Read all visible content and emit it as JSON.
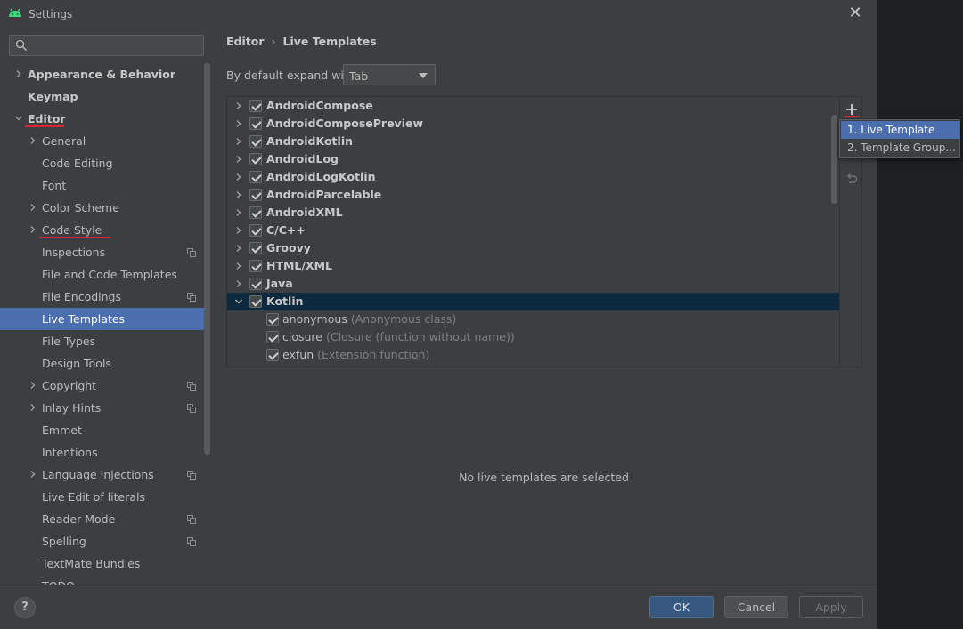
{
  "window": {
    "title": "Settings",
    "close_glyph": "✕"
  },
  "search": {
    "value": "",
    "placeholder": ""
  },
  "sidebar": {
    "items": [
      {
        "label": "Appearance & Behavior",
        "level": 0,
        "chevron": "right",
        "bold": true
      },
      {
        "label": "Keymap",
        "level": 0,
        "chevron": "none",
        "bold": true
      },
      {
        "label": "Editor",
        "level": 0,
        "chevron": "down",
        "bold": true
      },
      {
        "label": "General",
        "level": 1,
        "chevron": "right"
      },
      {
        "label": "Code Editing",
        "level": 1,
        "chevron": "none"
      },
      {
        "label": "Font",
        "level": 1,
        "chevron": "none"
      },
      {
        "label": "Color Scheme",
        "level": 1,
        "chevron": "right"
      },
      {
        "label": "Code Style",
        "level": 1,
        "chevron": "right"
      },
      {
        "label": "Inspections",
        "level": 1,
        "chevron": "none",
        "badge": true
      },
      {
        "label": "File and Code Templates",
        "level": 1,
        "chevron": "none"
      },
      {
        "label": "File Encodings",
        "level": 1,
        "chevron": "none",
        "badge": true
      },
      {
        "label": "Live Templates",
        "level": 1,
        "chevron": "none",
        "selected": true
      },
      {
        "label": "File Types",
        "level": 1,
        "chevron": "none"
      },
      {
        "label": "Design Tools",
        "level": 1,
        "chevron": "none"
      },
      {
        "label": "Copyright",
        "level": 1,
        "chevron": "right",
        "badge": true
      },
      {
        "label": "Inlay Hints",
        "level": 1,
        "chevron": "right",
        "badge": true
      },
      {
        "label": "Emmet",
        "level": 1,
        "chevron": "none"
      },
      {
        "label": "Intentions",
        "level": 1,
        "chevron": "none"
      },
      {
        "label": "Language Injections",
        "level": 1,
        "chevron": "right",
        "badge": true
      },
      {
        "label": "Live Edit of literals",
        "level": 1,
        "chevron": "none"
      },
      {
        "label": "Reader Mode",
        "level": 1,
        "chevron": "none",
        "badge": true
      },
      {
        "label": "Spelling",
        "level": 1,
        "chevron": "none",
        "badge": true
      },
      {
        "label": "TextMate Bundles",
        "level": 1,
        "chevron": "none"
      },
      {
        "label": "TODO",
        "level": 1,
        "chevron": "none"
      }
    ]
  },
  "breadcrumb": {
    "parent": "Editor",
    "separator": "›",
    "current": "Live Templates"
  },
  "expand": {
    "label": "By default expand with",
    "selected": "Tab"
  },
  "templates": [
    {
      "name": "AndroidCompose",
      "type": "group",
      "checked": true
    },
    {
      "name": "AndroidComposePreview",
      "type": "group",
      "checked": true
    },
    {
      "name": "AndroidKotlin",
      "type": "group",
      "checked": true
    },
    {
      "name": "AndroidLog",
      "type": "group",
      "checked": true
    },
    {
      "name": "AndroidLogKotlin",
      "type": "group",
      "checked": true
    },
    {
      "name": "AndroidParcelable",
      "type": "group",
      "checked": true
    },
    {
      "name": "AndroidXML",
      "type": "group",
      "checked": true
    },
    {
      "name": "C/C++",
      "type": "group",
      "checked": true
    },
    {
      "name": "Groovy",
      "type": "group",
      "checked": true
    },
    {
      "name": "HTML/XML",
      "type": "group",
      "checked": true
    },
    {
      "name": "Java",
      "type": "group",
      "checked": true
    },
    {
      "name": "Kotlin",
      "type": "group",
      "checked": true,
      "expanded": true,
      "selected": true
    },
    {
      "name": "anonymous",
      "desc": "(Anonymous class)",
      "type": "child",
      "checked": true
    },
    {
      "name": "closure",
      "desc": "(Closure (function without name))",
      "type": "child",
      "checked": true
    },
    {
      "name": "exfun",
      "desc": "(Extension function)",
      "type": "child",
      "checked": true
    }
  ],
  "toolbar": {
    "add_glyph": "+",
    "undo_icon": "undo-icon"
  },
  "popup": {
    "items": [
      "1. Live Template",
      "2. Template Group..."
    ]
  },
  "empty_message": "No live templates are selected",
  "footer": {
    "help": "?",
    "ok": "OK",
    "cancel": "Cancel",
    "apply": "Apply"
  },
  "colors": {
    "selection": "#4b6eaf",
    "tree_selection": "#0d293e",
    "annotation": "#d8262e",
    "android_green": "#3ddc84"
  }
}
